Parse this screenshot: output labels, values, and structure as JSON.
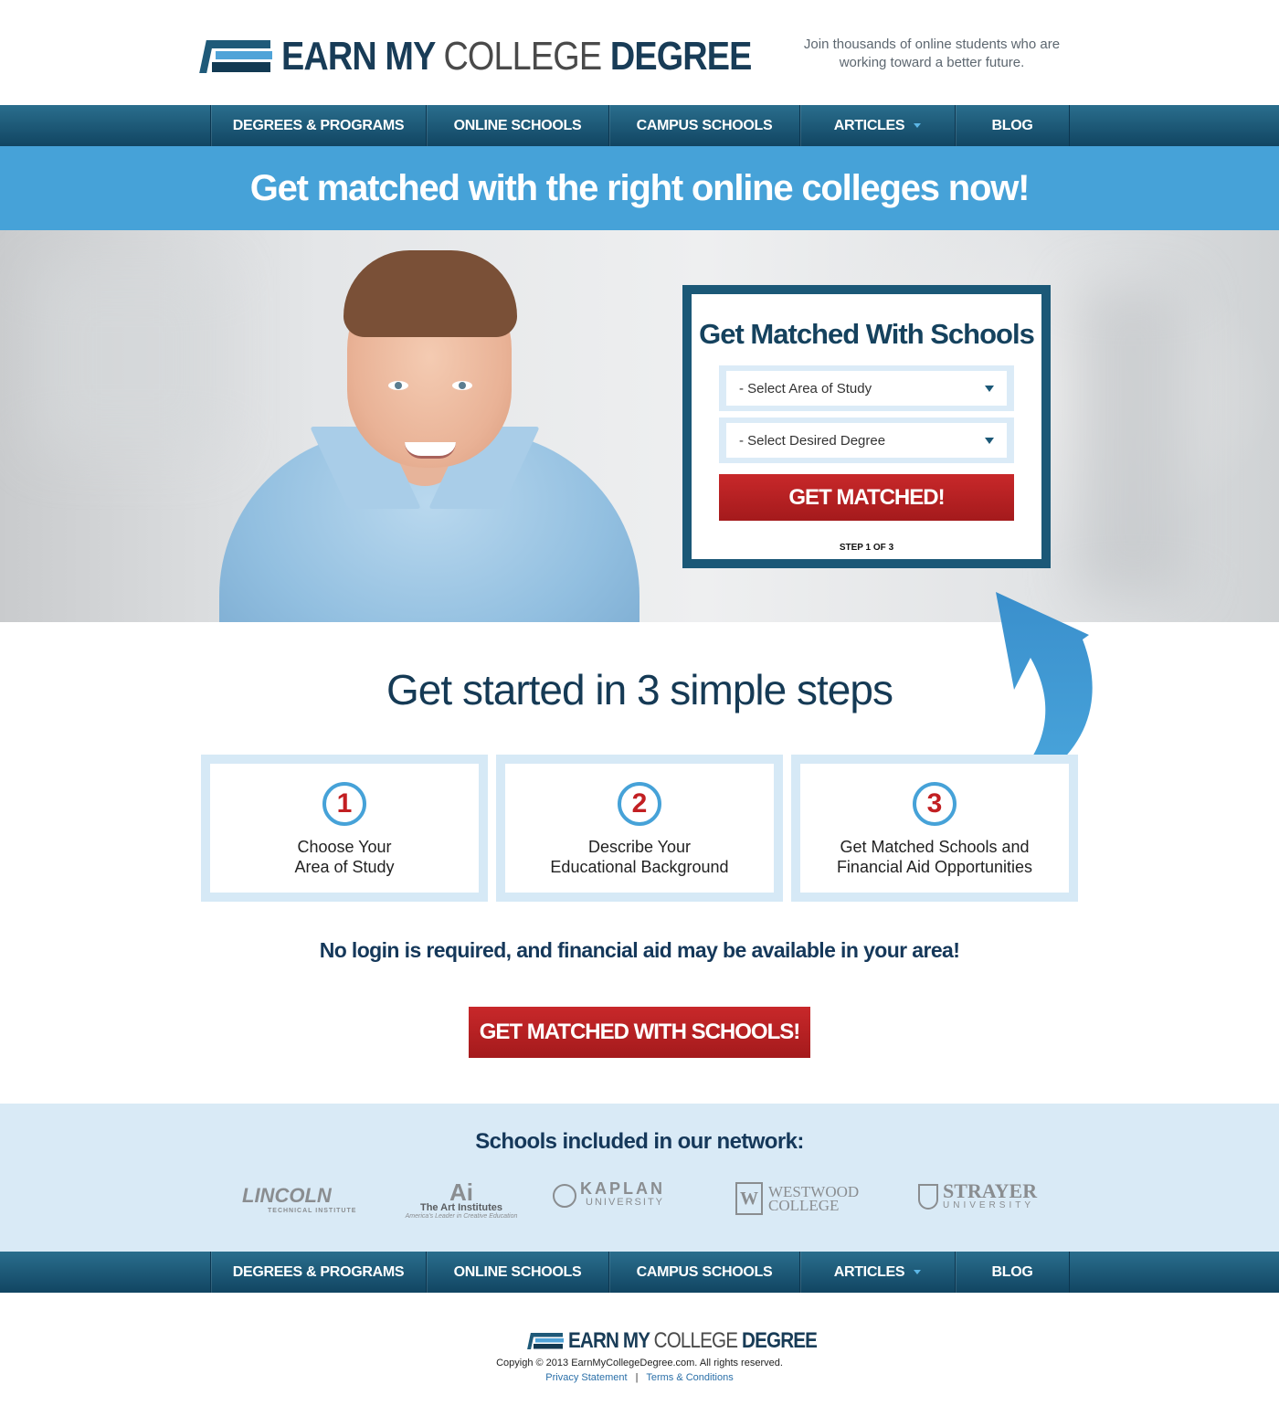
{
  "header": {
    "logo_text_1": "EARN MY",
    "logo_text_2": "COLLEGE",
    "logo_text_3": "DEGREE",
    "tagline_line1": "Join thousands of online students who are",
    "tagline_line2": "working toward a better future."
  },
  "nav": {
    "items": [
      {
        "label": "DEGREES & PROGRAMS"
      },
      {
        "label": "ONLINE SCHOOLS"
      },
      {
        "label": "CAMPUS SCHOOLS"
      },
      {
        "label": "ARTICLES",
        "has_dropdown": true
      },
      {
        "label": "BLOG"
      }
    ]
  },
  "banner": {
    "headline": "Get matched with the right online colleges now!"
  },
  "form": {
    "title": "Get Matched With Schools",
    "area_of_study": "- Select Area of Study",
    "desired_degree": "- Select Desired Degree",
    "submit_label": "GET MATCHED!",
    "step_text": "STEP 1 OF 3"
  },
  "steps": {
    "title": "Get started in 3 simple steps",
    "items": [
      {
        "number": "1",
        "line1": "Choose Your",
        "line2": "Area of Study"
      },
      {
        "number": "2",
        "line1": "Describe Your",
        "line2": "Educational Background"
      },
      {
        "number": "3",
        "line1": "Get Matched Schools and",
        "line2": "Financial Aid Opportunities"
      }
    ]
  },
  "cta": {
    "note": "No login is required, and financial aid may be available in your area!",
    "button_label": "GET MATCHED WITH SCHOOLS!"
  },
  "network": {
    "title": "Schools included in our network:",
    "schools": {
      "lincoln": {
        "name": "LINCOLN",
        "sub": "TECHNICAL INSTITUTE"
      },
      "art": {
        "mark": "Ai",
        "name": "The Art Institutes",
        "tagline": "America's Leader in Creative Education"
      },
      "kaplan": {
        "name": "KAPLAN",
        "sub": "UNIVERSITY"
      },
      "westwood": {
        "mark": "W",
        "line1": "WESTWOOD",
        "line2": "COLLEGE"
      },
      "strayer": {
        "name": "STRAYER",
        "sub": "UNIVERSITY"
      }
    }
  },
  "footer": {
    "copyright": "Copyigh © 2013 EarnMyCollegeDegree.com. All rights reserved.",
    "privacy_label": "Privacy Statement",
    "separator": "|",
    "terms_label": "Terms & Conditions"
  },
  "colors": {
    "nav_dark": "#114562",
    "banner_blue": "#46a2d8",
    "brand_navy": "#15425e",
    "cta_red": "#c21f22",
    "light_blue_panel": "#d9eaf6"
  }
}
